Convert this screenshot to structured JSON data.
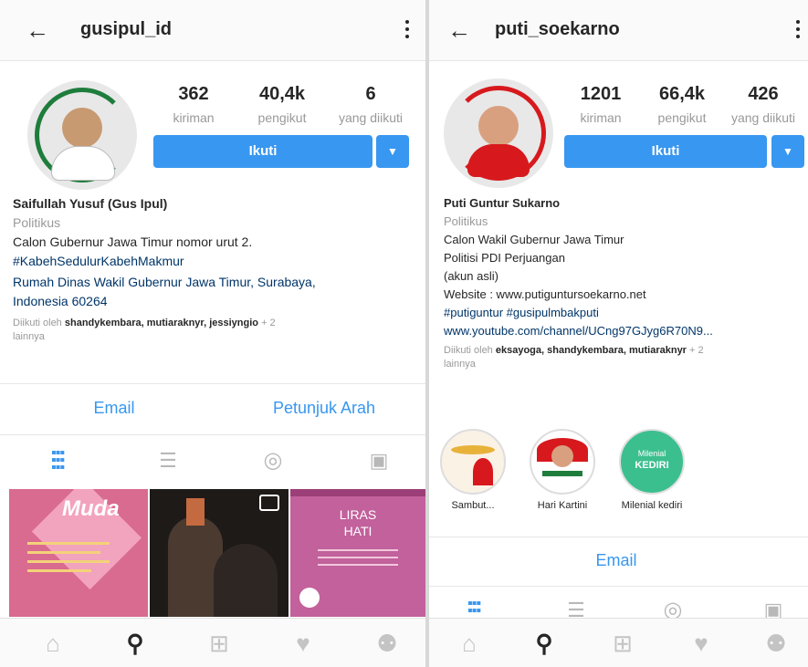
{
  "left": {
    "username": "gusipul_id",
    "stats": [
      {
        "num": "362",
        "label": "kiriman"
      },
      {
        "num": "40,4k",
        "label": "pengikut"
      },
      {
        "num": "6",
        "label": "yang diikuti"
      }
    ],
    "follow_label": "Ikuti",
    "bio": {
      "name": "Saifullah Yusuf (Gus Ipul)",
      "category": "Politikus",
      "line1": "Calon Gubernur Jawa Timur nomor urut 2.",
      "hashtags": "#KabehSedulurKabehMakmur",
      "address1": "Rumah Dinas Wakil Gubernur Jawa Timur, Surabaya,",
      "address2": "Indonesia 60264",
      "followed_prefix": "Diikuti oleh ",
      "followed_by": "shandykembara, mutiaraknyr, jessiyngio",
      "followed_suffix": " + 2",
      "followed_more": "lainnya"
    },
    "actions": [
      "Email",
      "Petunjuk Arah"
    ],
    "thumb_texts": [
      "Muda",
      "LIRAS",
      "HATI"
    ]
  },
  "right": {
    "username": "puti_soekarno",
    "stats": [
      {
        "num": "1201",
        "label": "kiriman"
      },
      {
        "num": "66,4k",
        "label": "pengikut"
      },
      {
        "num": "426",
        "label": "yang diikuti"
      }
    ],
    "follow_label": "Ikuti",
    "bio": {
      "name": "Puti Guntur Sukarno",
      "category": "Politikus",
      "line1": "Calon Wakil Gubernur Jawa Timur",
      "line2": "Politisi PDI Perjuangan",
      "line3": "(akun asli)",
      "website": "Website : www.putiguntursoekarno.net",
      "hashtags": "#putiguntur #gusipulmbakputi",
      "youtube": "www.youtube.com/channel/UCng97GJyg6R70N9...",
      "followed_prefix": "Diikuti oleh ",
      "followed_by": "eksayoga, shandykembara, mutiaraknyr",
      "followed_suffix": " + 2",
      "followed_more": "lainnya"
    },
    "highlights": [
      "Sambut...",
      "Hari Kartini",
      "Milenial kediri"
    ],
    "highlight_texts": [
      "Milenial",
      "KEDIRI"
    ],
    "actions": [
      "Email"
    ]
  },
  "colors": {
    "accent": "#3897f0",
    "gusipul_ring": "#1e7d3c",
    "puti_ring": "#d7191e",
    "thumb_pink": "#d96a90",
    "thumb_purple": "#c2619c"
  },
  "icons": {
    "back": "arrow-left-icon",
    "more": "more-vertical-icon",
    "grid": "grid-icon",
    "list": "list-icon",
    "tagged": "tagged-icon",
    "saved": "saved-icon",
    "nav": [
      "home-icon",
      "search-icon",
      "add-icon",
      "heart-icon",
      "profile-icon"
    ]
  }
}
